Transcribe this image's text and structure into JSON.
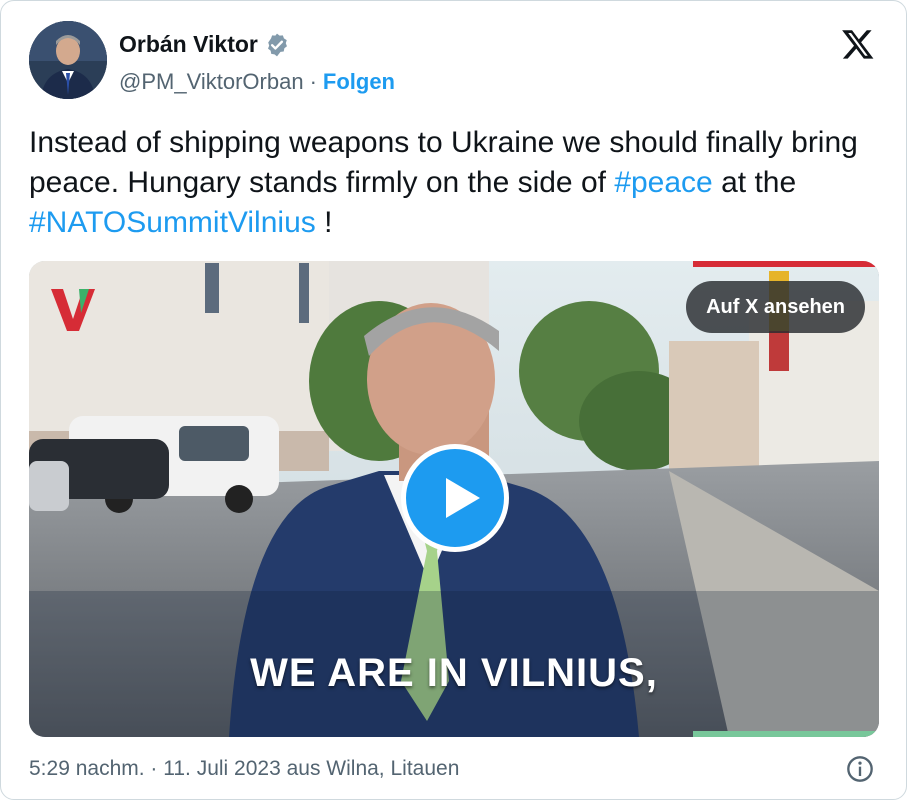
{
  "author": {
    "display_name": "Orbán Viktor",
    "handle": "@PM_ViktorOrban",
    "separator": "·",
    "follow_label": "Folgen",
    "verified_icon": "verified-badge-icon",
    "verified_color": "#829aab"
  },
  "brand": {
    "logo": "x-logo-icon"
  },
  "tweet": {
    "text_1": "Instead of shipping weapons to Ukraine we should finally bring peace. Hungary stands firmly on the side of ",
    "hashtag_1": "#peace",
    "text_2": " at the ",
    "hashtag_2": "#NATOSummitVilnius",
    "text_3": " !"
  },
  "media": {
    "type": "video",
    "view_on_x_label": "Auf X ansehen",
    "caption": "WE ARE IN VILNIUS,",
    "play_icon": "play-icon"
  },
  "footer": {
    "timestamp": "5:29 nachm. · 11. Juli 2023 aus Wilna, Litauen",
    "info_icon": "info-icon"
  },
  "colors": {
    "accent": "#1d9bf0",
    "text": "#0f1419",
    "muted": "#536471"
  }
}
